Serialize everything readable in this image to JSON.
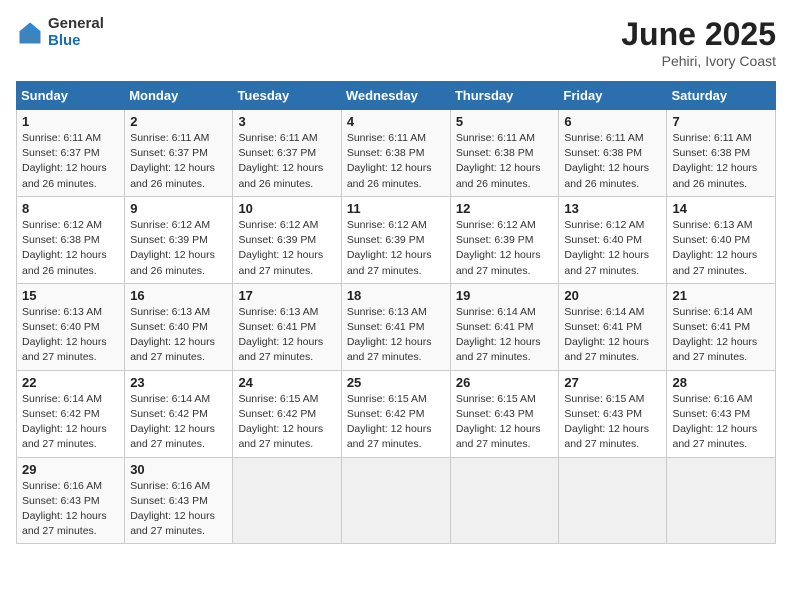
{
  "logo": {
    "general": "General",
    "blue": "Blue"
  },
  "title": {
    "month": "June 2025",
    "location": "Pehiri, Ivory Coast"
  },
  "headers": [
    "Sunday",
    "Monday",
    "Tuesday",
    "Wednesday",
    "Thursday",
    "Friday",
    "Saturday"
  ],
  "weeks": [
    [
      {
        "day": "1",
        "sunrise": "Sunrise: 6:11 AM",
        "sunset": "Sunset: 6:37 PM",
        "daylight": "Daylight: 12 hours and 26 minutes."
      },
      {
        "day": "2",
        "sunrise": "Sunrise: 6:11 AM",
        "sunset": "Sunset: 6:37 PM",
        "daylight": "Daylight: 12 hours and 26 minutes."
      },
      {
        "day": "3",
        "sunrise": "Sunrise: 6:11 AM",
        "sunset": "Sunset: 6:37 PM",
        "daylight": "Daylight: 12 hours and 26 minutes."
      },
      {
        "day": "4",
        "sunrise": "Sunrise: 6:11 AM",
        "sunset": "Sunset: 6:38 PM",
        "daylight": "Daylight: 12 hours and 26 minutes."
      },
      {
        "day": "5",
        "sunrise": "Sunrise: 6:11 AM",
        "sunset": "Sunset: 6:38 PM",
        "daylight": "Daylight: 12 hours and 26 minutes."
      },
      {
        "day": "6",
        "sunrise": "Sunrise: 6:11 AM",
        "sunset": "Sunset: 6:38 PM",
        "daylight": "Daylight: 12 hours and 26 minutes."
      },
      {
        "day": "7",
        "sunrise": "Sunrise: 6:11 AM",
        "sunset": "Sunset: 6:38 PM",
        "daylight": "Daylight: 12 hours and 26 minutes."
      }
    ],
    [
      {
        "day": "8",
        "sunrise": "Sunrise: 6:12 AM",
        "sunset": "Sunset: 6:38 PM",
        "daylight": "Daylight: 12 hours and 26 minutes."
      },
      {
        "day": "9",
        "sunrise": "Sunrise: 6:12 AM",
        "sunset": "Sunset: 6:39 PM",
        "daylight": "Daylight: 12 hours and 26 minutes."
      },
      {
        "day": "10",
        "sunrise": "Sunrise: 6:12 AM",
        "sunset": "Sunset: 6:39 PM",
        "daylight": "Daylight: 12 hours and 27 minutes."
      },
      {
        "day": "11",
        "sunrise": "Sunrise: 6:12 AM",
        "sunset": "Sunset: 6:39 PM",
        "daylight": "Daylight: 12 hours and 27 minutes."
      },
      {
        "day": "12",
        "sunrise": "Sunrise: 6:12 AM",
        "sunset": "Sunset: 6:39 PM",
        "daylight": "Daylight: 12 hours and 27 minutes."
      },
      {
        "day": "13",
        "sunrise": "Sunrise: 6:12 AM",
        "sunset": "Sunset: 6:40 PM",
        "daylight": "Daylight: 12 hours and 27 minutes."
      },
      {
        "day": "14",
        "sunrise": "Sunrise: 6:13 AM",
        "sunset": "Sunset: 6:40 PM",
        "daylight": "Daylight: 12 hours and 27 minutes."
      }
    ],
    [
      {
        "day": "15",
        "sunrise": "Sunrise: 6:13 AM",
        "sunset": "Sunset: 6:40 PM",
        "daylight": "Daylight: 12 hours and 27 minutes."
      },
      {
        "day": "16",
        "sunrise": "Sunrise: 6:13 AM",
        "sunset": "Sunset: 6:40 PM",
        "daylight": "Daylight: 12 hours and 27 minutes."
      },
      {
        "day": "17",
        "sunrise": "Sunrise: 6:13 AM",
        "sunset": "Sunset: 6:41 PM",
        "daylight": "Daylight: 12 hours and 27 minutes."
      },
      {
        "day": "18",
        "sunrise": "Sunrise: 6:13 AM",
        "sunset": "Sunset: 6:41 PM",
        "daylight": "Daylight: 12 hours and 27 minutes."
      },
      {
        "day": "19",
        "sunrise": "Sunrise: 6:14 AM",
        "sunset": "Sunset: 6:41 PM",
        "daylight": "Daylight: 12 hours and 27 minutes."
      },
      {
        "day": "20",
        "sunrise": "Sunrise: 6:14 AM",
        "sunset": "Sunset: 6:41 PM",
        "daylight": "Daylight: 12 hours and 27 minutes."
      },
      {
        "day": "21",
        "sunrise": "Sunrise: 6:14 AM",
        "sunset": "Sunset: 6:41 PM",
        "daylight": "Daylight: 12 hours and 27 minutes."
      }
    ],
    [
      {
        "day": "22",
        "sunrise": "Sunrise: 6:14 AM",
        "sunset": "Sunset: 6:42 PM",
        "daylight": "Daylight: 12 hours and 27 minutes."
      },
      {
        "day": "23",
        "sunrise": "Sunrise: 6:14 AM",
        "sunset": "Sunset: 6:42 PM",
        "daylight": "Daylight: 12 hours and 27 minutes."
      },
      {
        "day": "24",
        "sunrise": "Sunrise: 6:15 AM",
        "sunset": "Sunset: 6:42 PM",
        "daylight": "Daylight: 12 hours and 27 minutes."
      },
      {
        "day": "25",
        "sunrise": "Sunrise: 6:15 AM",
        "sunset": "Sunset: 6:42 PM",
        "daylight": "Daylight: 12 hours and 27 minutes."
      },
      {
        "day": "26",
        "sunrise": "Sunrise: 6:15 AM",
        "sunset": "Sunset: 6:43 PM",
        "daylight": "Daylight: 12 hours and 27 minutes."
      },
      {
        "day": "27",
        "sunrise": "Sunrise: 6:15 AM",
        "sunset": "Sunset: 6:43 PM",
        "daylight": "Daylight: 12 hours and 27 minutes."
      },
      {
        "day": "28",
        "sunrise": "Sunrise: 6:16 AM",
        "sunset": "Sunset: 6:43 PM",
        "daylight": "Daylight: 12 hours and 27 minutes."
      }
    ],
    [
      {
        "day": "29",
        "sunrise": "Sunrise: 6:16 AM",
        "sunset": "Sunset: 6:43 PM",
        "daylight": "Daylight: 12 hours and 27 minutes."
      },
      {
        "day": "30",
        "sunrise": "Sunrise: 6:16 AM",
        "sunset": "Sunset: 6:43 PM",
        "daylight": "Daylight: 12 hours and 27 minutes."
      },
      null,
      null,
      null,
      null,
      null
    ]
  ]
}
